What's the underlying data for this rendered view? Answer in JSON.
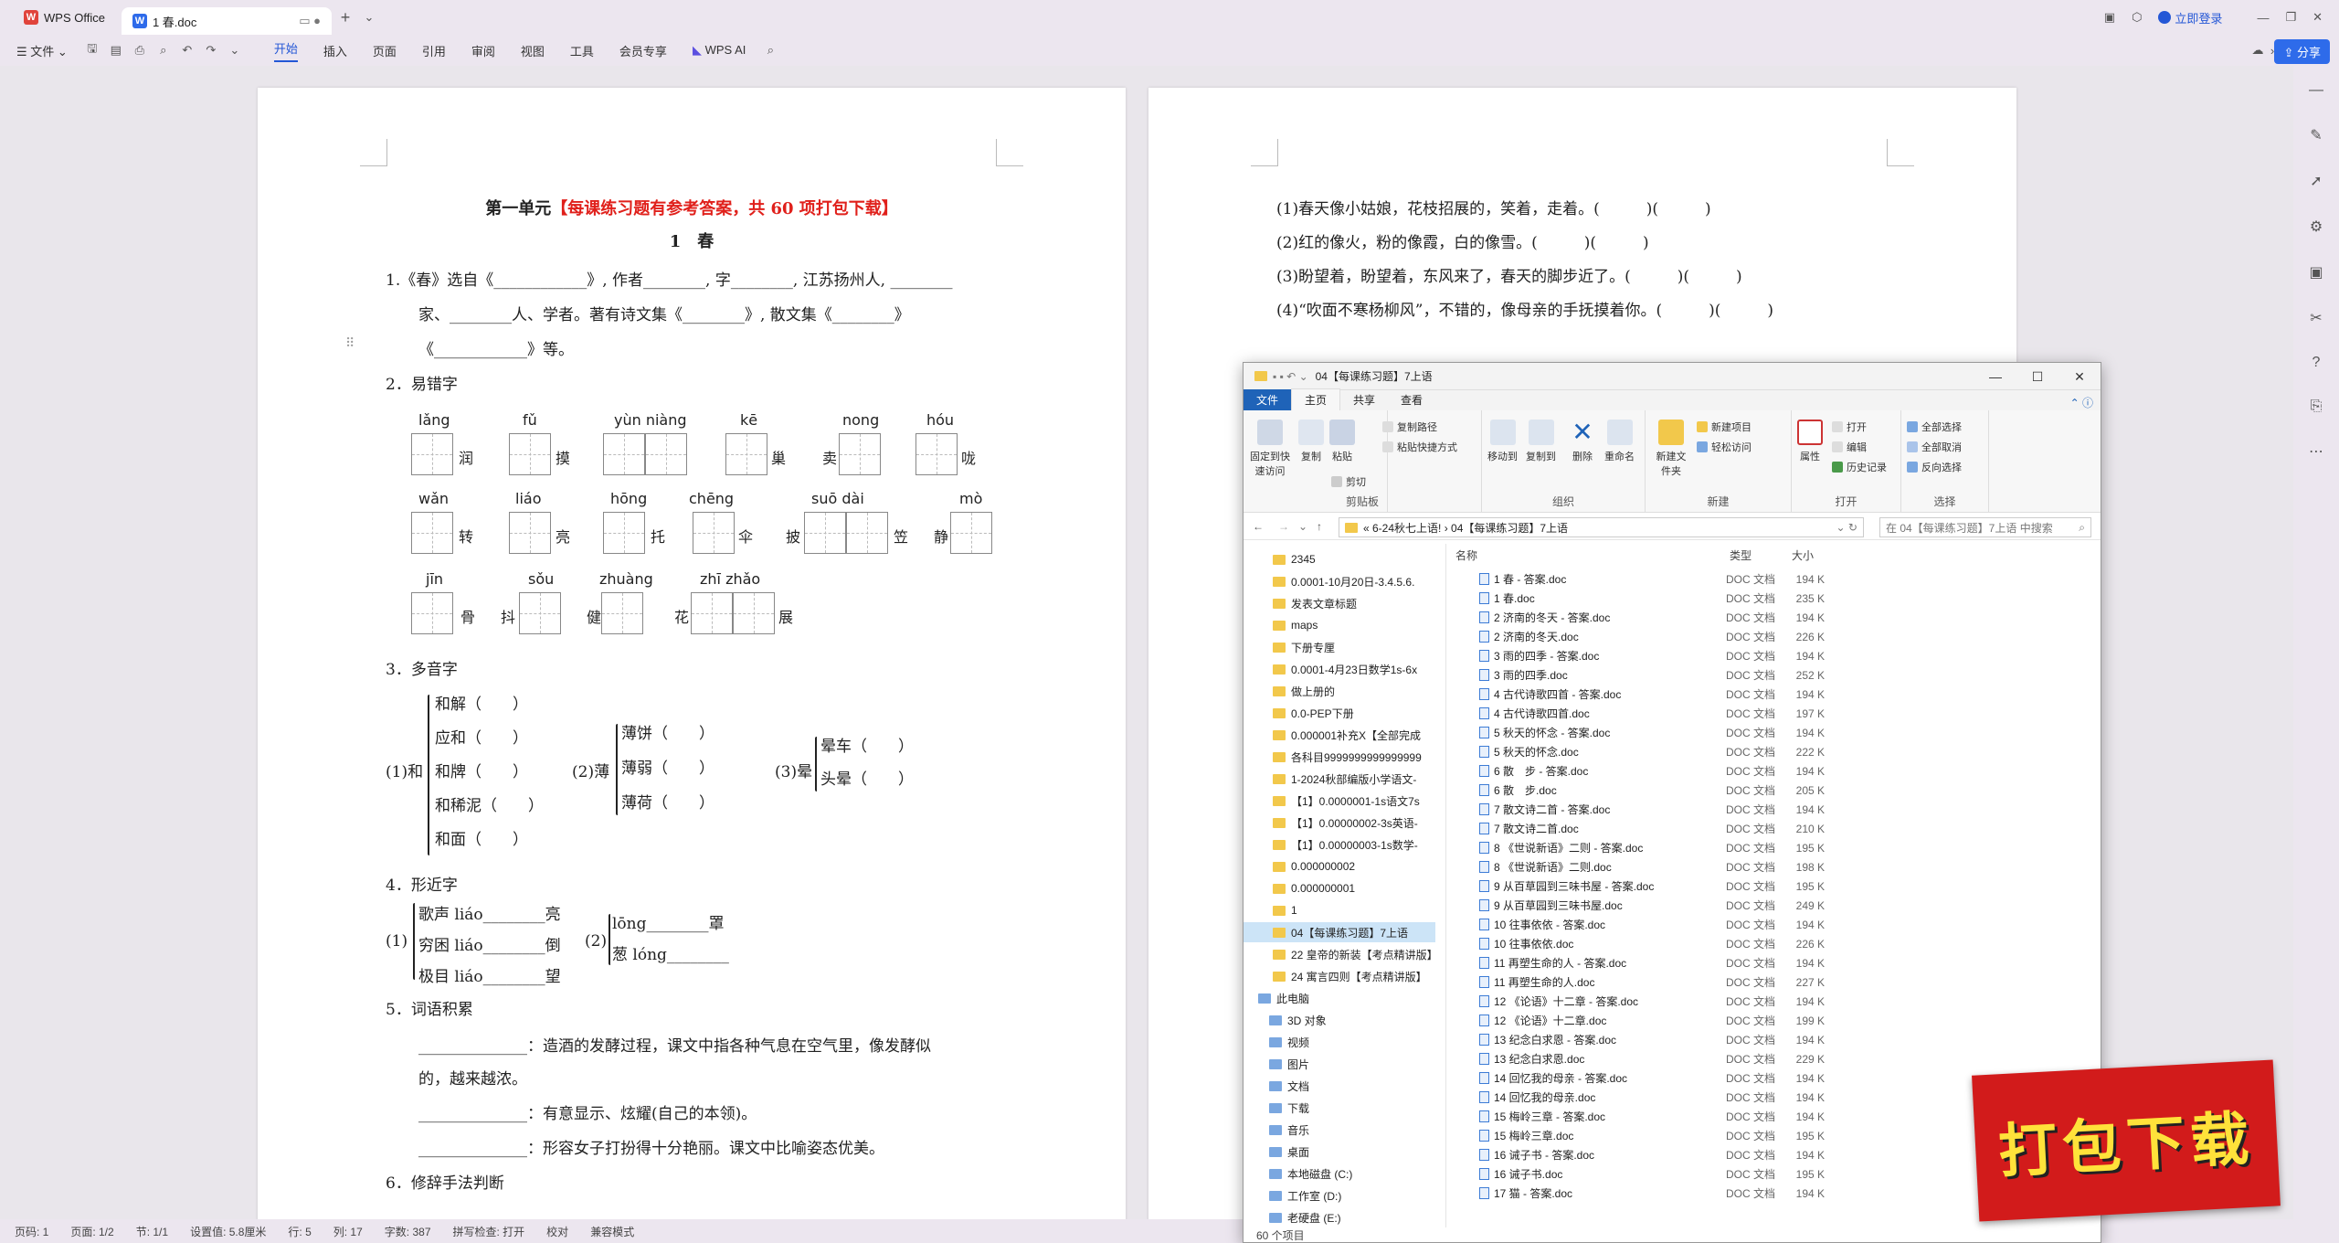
{
  "titlebar": {
    "app_tab": "WPS Office",
    "doc_tab": "1  春.doc",
    "login": "立即登录"
  },
  "menu": {
    "file": "文件",
    "tabs": [
      "开始",
      "插入",
      "页面",
      "引用",
      "审阅",
      "视图",
      "工具",
      "会员专享"
    ],
    "wps_ai": "WPS AI",
    "share": "分享"
  },
  "page1": {
    "title_black": "第一单元",
    "title_red": "【每课练习题有参考答案，共 60 项打包下载】",
    "subtitle": "1　春",
    "q1_l1": "1.《春》选自《____________》, 作者________, 字________, 江苏扬州人, ________",
    "q1_l2": "家、________人、学者。著有诗文集《________》, 散文集《________》",
    "q1_l3": "《____________》等。",
    "q2": "2．易错字",
    "q2_py": [
      "lǎng",
      "fǔ",
      "yùn niàng",
      "kē",
      "nong",
      "hóu",
      "wǎn",
      "liáo",
      "hōng",
      "chēng",
      "suō dài",
      "mò",
      "jīn",
      "sǒu",
      "zhuàng",
      "zhī zhǎo"
    ],
    "q2_ch": [
      "润",
      "摸",
      "巢",
      "卖",
      "咙",
      "转",
      "亮",
      "托",
      "伞",
      "披",
      "笠",
      "静",
      "骨",
      "抖",
      "健",
      "花",
      "展"
    ],
    "q3": "3．多音字",
    "q3_g1": [
      "(1)和",
      "和解（　　）",
      "应和（　　）",
      "和牌（　　）",
      "和稀泥（　　）",
      "和面（　　）"
    ],
    "q3_g2": [
      "(2)薄",
      "薄饼（　　）",
      "薄弱（　　）",
      "薄荷（　　）"
    ],
    "q3_g3": [
      "(3)晕",
      "晕车（　　）",
      "头晕（　　）"
    ],
    "q4": "4．形近字",
    "q4_g1": [
      "(1)",
      "歌声 liáo________亮",
      "穷困 liáo________倒",
      "极目 liáo________望"
    ],
    "q4_g2": [
      "(2)",
      "lōng________罩",
      "葱 lóng________"
    ],
    "q5": "5．词语积累",
    "q5_l1": "______________：造酒的发酵过程，课文中指各种气息在空气里，像发酵似",
    "q5_l2": "的，越来越浓。",
    "q5_l3": "______________：有意显示、炫耀(自己的本领)。",
    "q5_l4": "______________：形容女子打扮得十分艳丽。课文中比喻姿态优美。",
    "q6": "6．修辞手法判断"
  },
  "page2": {
    "lines": [
      "(1)春天像小姑娘，花枝招展的，笑着，走着。(　　　)(　　　)",
      "(2)红的像火，粉的像霞，白的像雪。(　　　)(　　　)",
      "(3)盼望着，盼望着，东风来了，春天的脚步近了。(　　　)(　　　)",
      "(4)“吹面不寒杨柳风”，不错的，像母亲的手抚摸着你。(　　　)(　　　)"
    ]
  },
  "explorer": {
    "title": "04【每课练习题】7上语",
    "tabs": [
      "文件",
      "主页",
      "共享",
      "查看"
    ],
    "ribbon": {
      "pin": "固定到快速访问",
      "copy": "复制",
      "paste": "粘贴",
      "copy_path": "复制路径",
      "paste_shortcut": "粘贴快捷方式",
      "cut": "剪切",
      "clip_label": "剪贴板",
      "move_to": "移动到",
      "copy_to": "复制到",
      "delete": "删除",
      "rename": "重命名",
      "org_label": "组织",
      "new_folder": "新建文件夹",
      "new_item": "新建项目",
      "easy_access": "轻松访问",
      "new_label": "新建",
      "props": "属性",
      "open": "打开",
      "edit": "编辑",
      "history": "历史记录",
      "open_label": "打开",
      "select_all": "全部选择",
      "select_none": "全部取消",
      "invert": "反向选择",
      "select_label": "选择"
    },
    "address": "«  6-24秋七上语!  ›  04【每课练习题】7上语",
    "search": "在 04【每课练习题】7上语 中搜索",
    "nav": [
      "2345",
      "0.0001-10月20日-3.4.5.6.",
      "发表文章标题",
      "maps",
      "下册专厘",
      "0.0001-4月23日数学1s-6x",
      "做上册的",
      "0.0-PEP下册",
      "0.000001补充X【全部完成",
      "各科目9999999999999999",
      "1-2024秋部编版小学语文-",
      "【1】0.0000001-1s语文7s",
      "【1】0.00000002-3s英语-",
      "【1】0.00000003-1s数学-",
      "0.000000002",
      "0.000000001",
      "1",
      "04【每课练习题】7上语",
      "22 皇帝的新装【考点精讲版】",
      "24 寓言四则【考点精讲版】",
      "此电脑",
      "3D 对象",
      "视频",
      "图片",
      "文档",
      "下载",
      "音乐",
      "桌面",
      "本地磁盘 (C:)",
      "工作室 (D:)",
      "老硬盘 (E:)"
    ],
    "headers": {
      "name": "名称",
      "type": "类型",
      "size": "大小"
    },
    "files": [
      [
        "1  春 - 答案.doc",
        "DOC 文档",
        "194 K"
      ],
      [
        "1  春.doc",
        "DOC 文档",
        "235 K"
      ],
      [
        "2  济南的冬天 - 答案.doc",
        "DOC 文档",
        "194 K"
      ],
      [
        "2  济南的冬天.doc",
        "DOC 文档",
        "226 K"
      ],
      [
        "3  雨的四季 - 答案.doc",
        "DOC 文档",
        "194 K"
      ],
      [
        "3  雨的四季.doc",
        "DOC 文档",
        "252 K"
      ],
      [
        "4  古代诗歌四首 - 答案.doc",
        "DOC 文档",
        "194 K"
      ],
      [
        "4  古代诗歌四首.doc",
        "DOC 文档",
        "197 K"
      ],
      [
        "5  秋天的怀念 - 答案.doc",
        "DOC 文档",
        "194 K"
      ],
      [
        "5  秋天的怀念.doc",
        "DOC 文档",
        "222 K"
      ],
      [
        "6  散　步 - 答案.doc",
        "DOC 文档",
        "194 K"
      ],
      [
        "6  散　步.doc",
        "DOC 文档",
        "205 K"
      ],
      [
        "7  散文诗二首 - 答案.doc",
        "DOC 文档",
        "194 K"
      ],
      [
        "7  散文诗二首.doc",
        "DOC 文档",
        "210 K"
      ],
      [
        "8 《世说新语》二则 - 答案.doc",
        "DOC 文档",
        "195 K"
      ],
      [
        "8 《世说新语》二则.doc",
        "DOC 文档",
        "198 K"
      ],
      [
        "9  从百草园到三味书屋 - 答案.doc",
        "DOC 文档",
        "195 K"
      ],
      [
        "9  从百草园到三味书屋.doc",
        "DOC 文档",
        "249 K"
      ],
      [
        "10 往事依依 - 答案.doc",
        "DOC 文档",
        "194 K"
      ],
      [
        "10 往事依依.doc",
        "DOC 文档",
        "226 K"
      ],
      [
        "11  再塑生命的人 - 答案.doc",
        "DOC 文档",
        "194 K"
      ],
      [
        "11  再塑生命的人.doc",
        "DOC 文档",
        "227 K"
      ],
      [
        "12 《论语》十二章 - 答案.doc",
        "DOC 文档",
        "194 K"
      ],
      [
        "12 《论语》十二章.doc",
        "DOC 文档",
        "199 K"
      ],
      [
        "13  纪念白求恩 - 答案.doc",
        "DOC 文档",
        "194 K"
      ],
      [
        "13  纪念白求恩.doc",
        "DOC 文档",
        "229 K"
      ],
      [
        "14 回忆我的母亲 - 答案.doc",
        "DOC 文档",
        "194 K"
      ],
      [
        "14 回忆我的母亲.doc",
        "DOC 文档",
        "194 K"
      ],
      [
        "15 梅岭三章 - 答案.doc",
        "DOC 文档",
        "194 K"
      ],
      [
        "15 梅岭三章.doc",
        "DOC 文档",
        "195 K"
      ],
      [
        "16  诫子书 - 答案.doc",
        "DOC 文档",
        "194 K"
      ],
      [
        "16  诫子书.doc",
        "DOC 文档",
        "195 K"
      ],
      [
        "17  猫 - 答案.doc",
        "DOC 文档",
        "194 K"
      ]
    ],
    "status": "60 个项目"
  },
  "statusbar": [
    "页码: 1",
    "页面: 1/2",
    "节: 1/1",
    "设置值: 5.8厘米",
    "行: 5",
    "列: 17",
    "字数: 387",
    "拼写检查: 打开",
    "校对",
    "兼容模式"
  ],
  "banner": "打包下载"
}
